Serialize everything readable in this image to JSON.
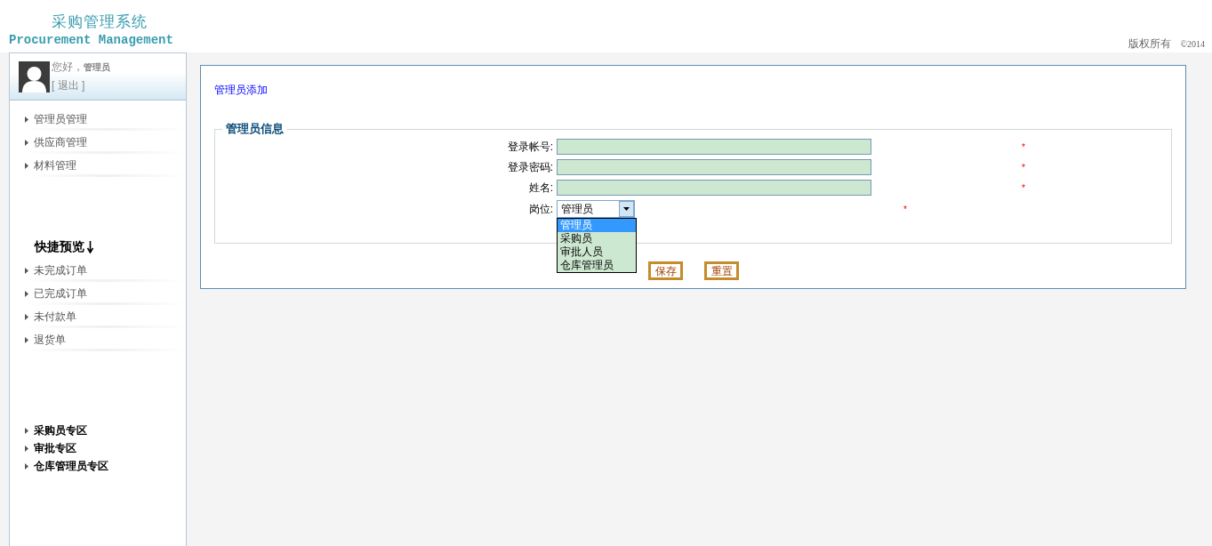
{
  "header": {
    "logo_title": "采购管理系统",
    "logo_subtitle": "Procurement Management",
    "copyright": "版权所有",
    "year": "©2014"
  },
  "sidebar": {
    "user": {
      "greeting": "您好，",
      "name": "管理员",
      "logout": "[ 退出 ]"
    },
    "menu": [
      {
        "label": "管理员管理"
      },
      {
        "label": "供应商管理"
      },
      {
        "label": "材料管理"
      }
    ],
    "quick_title": "快捷预览",
    "quick": [
      {
        "label": "未完成订单"
      },
      {
        "label": "已完成订单"
      },
      {
        "label": "未付款单"
      },
      {
        "label": "退货单"
      }
    ],
    "zones": [
      {
        "label": "采购员专区"
      },
      {
        "label": "审批专区"
      },
      {
        "label": "仓库管理员专区"
      }
    ]
  },
  "main": {
    "breadcrumb": "管理员添加",
    "fieldset_title": "管理员信息",
    "fields": [
      {
        "kind": "text",
        "label": "登录帐号:",
        "required_mark": "*"
      },
      {
        "kind": "text",
        "label": "登录密码:",
        "required_mark": "*"
      },
      {
        "kind": "text",
        "label": "姓名:",
        "required_mark": "*"
      },
      {
        "kind": "select",
        "label": "岗位:",
        "value": "管理员",
        "required_mark": "*",
        "expanded": true,
        "options": [
          {
            "label": "管理员",
            "selected": true
          },
          {
            "label": "采购员",
            "selected": false
          },
          {
            "label": "审批人员",
            "selected": false
          },
          {
            "label": "仓库管理员",
            "selected": false
          }
        ]
      }
    ],
    "buttons": [
      "保存",
      "重置"
    ]
  }
}
